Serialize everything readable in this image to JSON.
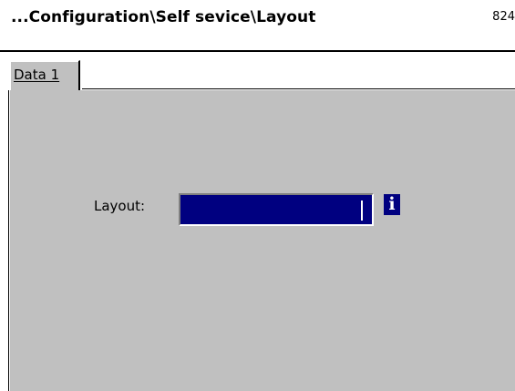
{
  "header": {
    "breadcrumb": "...Configuration\\Self sevice\\Layout",
    "screen_id": "824"
  },
  "tabs": [
    {
      "label": "Data 1",
      "active": true
    }
  ],
  "form": {
    "layout_label": "Layout:",
    "layout_value": ""
  },
  "icons": {
    "info": {
      "name": "info-icon",
      "glyph": "i"
    }
  },
  "colors": {
    "panel": "#c0c0c0",
    "input_background": "#000080",
    "info_icon": "#000080",
    "text": "#000000"
  }
}
